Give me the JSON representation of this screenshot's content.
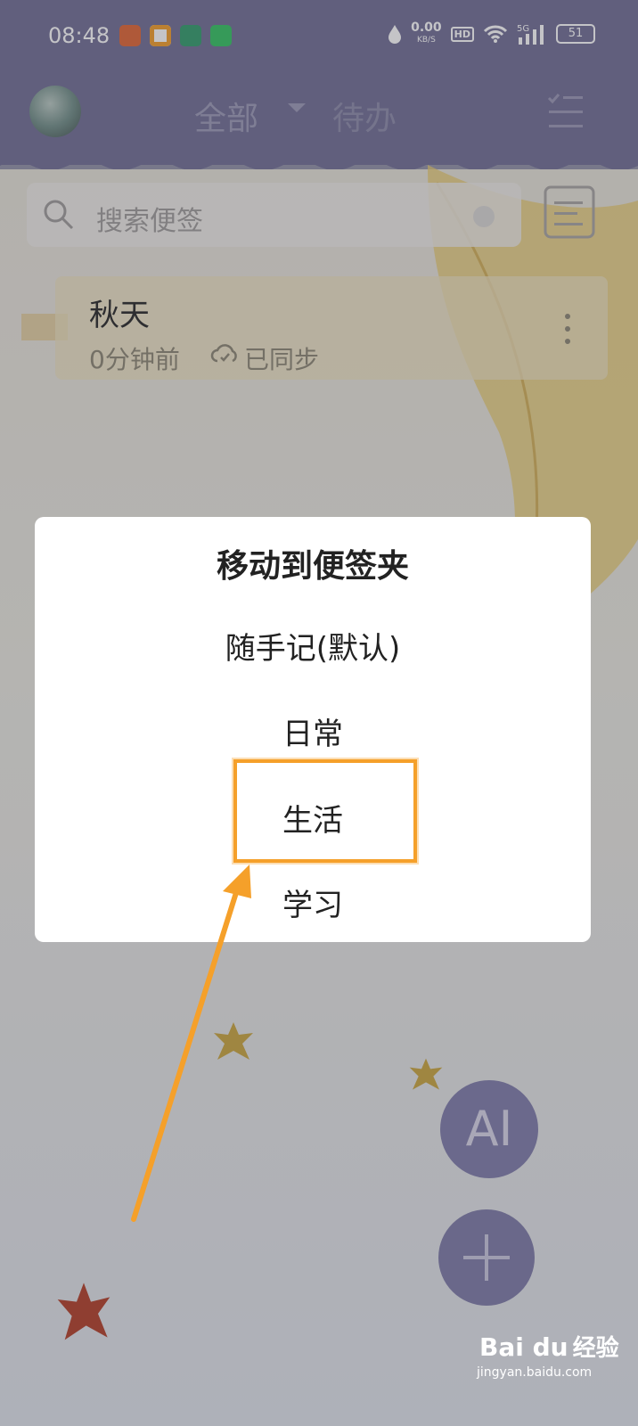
{
  "status_bar": {
    "time": "08:48",
    "net_speed": "0.00",
    "net_unit": "KB/S",
    "hd": "HD",
    "signal": "5G",
    "battery": "51"
  },
  "header": {
    "tab_all": "全部",
    "tab_todo": "待办"
  },
  "search": {
    "placeholder": "搜索便签"
  },
  "note": {
    "title": "秋天",
    "time": "0分钟前",
    "sync_status": "已同步"
  },
  "dialog": {
    "title": "移动到便签夹",
    "options": [
      "随手记(默认)",
      "日常",
      "生活",
      "学习"
    ],
    "highlighted": "生活"
  },
  "fab": {
    "ai_label": "AI"
  },
  "watermark": {
    "brand": "Bai du",
    "cn": "经验",
    "url": "jingyan.baidu.com"
  },
  "colors": {
    "header": "#6d6b92",
    "accent": "#f5a02a",
    "fab": "#7d7aa8"
  }
}
